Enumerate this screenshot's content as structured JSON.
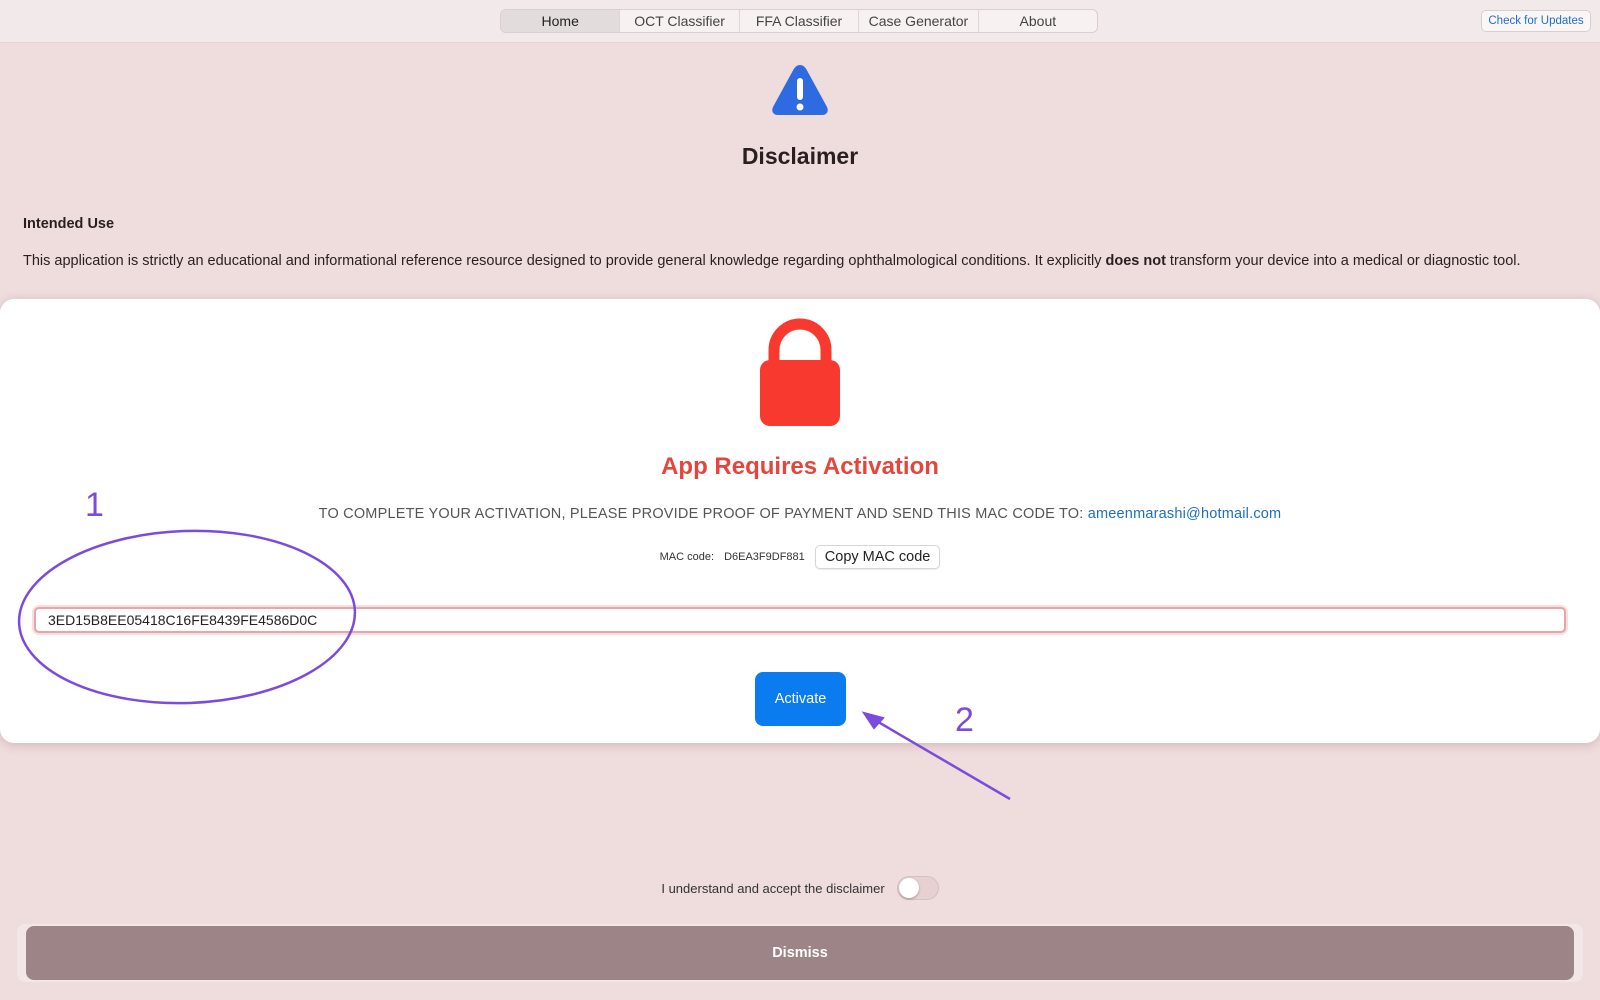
{
  "toolbar": {
    "tabs": [
      "Home",
      "OCT Classifier",
      "FFA Classifier",
      "Case Generator",
      "About"
    ],
    "active_tab": "Home",
    "check_updates_label": "Check for Updates"
  },
  "disclaimer": {
    "icon": "warning-triangle-icon",
    "title": "Disclaimer",
    "intended_use_heading": "Intended Use",
    "intended_use_text_before": "This application is strictly an educational and informational reference resource designed to provide general knowledge regarding ophthalmological conditions. It explicitly ",
    "intended_use_text_bold": "does not",
    "intended_use_text_after": " transform your device into a medical or diagnostic tool."
  },
  "activation": {
    "icon": "lock-icon",
    "title": "App Requires Activation",
    "instruction": "TO COMPLETE YOUR ACTIVATION, PLEASE PROVIDE PROOF OF PAYMENT AND SEND THIS MAC CODE TO:",
    "email": "ameenmarashi@hotmail.com",
    "mac_label": "MAC code:",
    "mac_value": "D6EA3F9DF881",
    "copy_button_label": "Copy MAC code",
    "key_value": "3ED15B8EE05418C16FE8439FE4586D0C",
    "activate_label": "Activate"
  },
  "annotations": {
    "step1": "1",
    "step2": "2"
  },
  "footer": {
    "accept_label": "I understand and accept the disclaimer",
    "accept_toggle_on": false,
    "dismiss_label": "Dismiss"
  },
  "colors": {
    "background": "#efdcdd",
    "accent_blue": "#0a7cf0",
    "activation_red": "#e5453b",
    "lock_red": "#f7392f",
    "warning_blue": "#2f6be0",
    "annotation_purple": "#7b4be0",
    "dismiss_button": "#9c8487"
  }
}
